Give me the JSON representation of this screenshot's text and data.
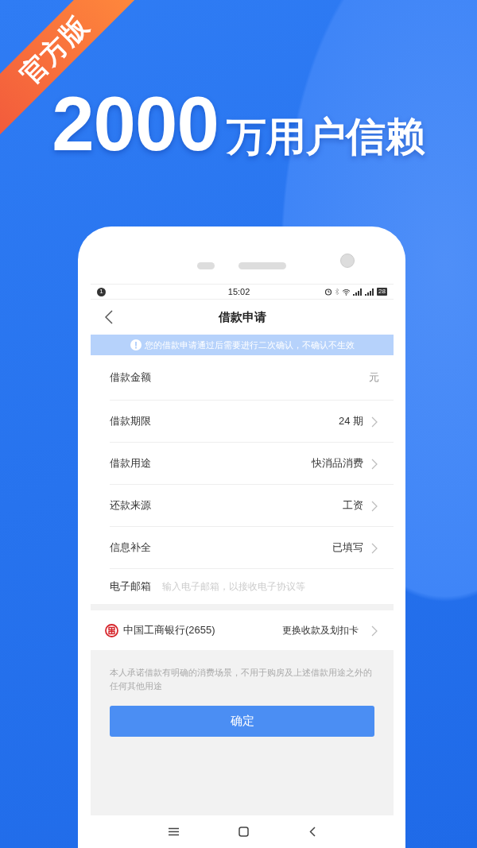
{
  "promo": {
    "badge": "官方版",
    "headline_number": "2000",
    "headline_text": "万用户信赖"
  },
  "status_bar": {
    "notification_count": "1",
    "time": "15:02",
    "battery": "28"
  },
  "nav": {
    "title": "借款申请"
  },
  "notice": "您的借款申请通过后需要进行二次确认，不确认不生效",
  "form_rows": [
    {
      "kind": "input",
      "label": "借款金额",
      "unit": "元"
    },
    {
      "kind": "select",
      "label": "借款期限",
      "value": "24 期"
    },
    {
      "kind": "select",
      "label": "借款用途",
      "value": "快消品消费"
    },
    {
      "kind": "select",
      "label": "还款来源",
      "value": "工资"
    },
    {
      "kind": "select",
      "label": "信息补全",
      "value": "已填写"
    },
    {
      "kind": "email",
      "label": "电子邮箱",
      "placeholder": "输入电子邮箱，以接收电子协议等"
    }
  ],
  "bank": {
    "name": "中国工商银行(2655)",
    "action": "更换收款及划扣卡"
  },
  "disclaimer": "本人承诺借款有明确的消费场景，不用于购房及上述借款用途之外的任何其他用途",
  "submit_button": "确定"
}
